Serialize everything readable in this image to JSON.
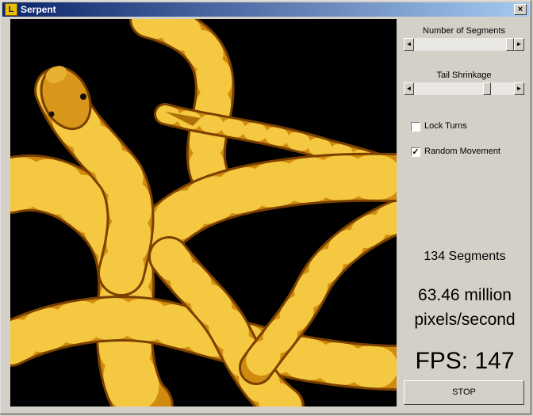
{
  "window": {
    "title": "Serpent",
    "app_icon_glyph": "L",
    "close_glyph": "×"
  },
  "controls": {
    "segments_slider": {
      "label": "Number of Segments",
      "left_arrow": "◄",
      "right_arrow": "►",
      "value_fraction": 1.0
    },
    "shrinkage_slider": {
      "label": "Tail Shrinkage",
      "left_arrow": "◄",
      "right_arrow": "►",
      "value_fraction": 0.75
    },
    "lock_turns": {
      "label": "Lock Turns",
      "checked": false,
      "mark": ""
    },
    "random_movement": {
      "label": "Random Movement",
      "checked": true,
      "mark": "✓"
    }
  },
  "stats": {
    "segments": "134 Segments",
    "rate_line1": "63.46 million",
    "rate_line2": "pixels/second",
    "fps": "FPS: 147"
  },
  "stop_button": "STOP",
  "colors": {
    "snake_gold": "#d08a10",
    "snake_dark": "#8a4a00",
    "snake_band": "#f4c030",
    "background": "#000000"
  }
}
